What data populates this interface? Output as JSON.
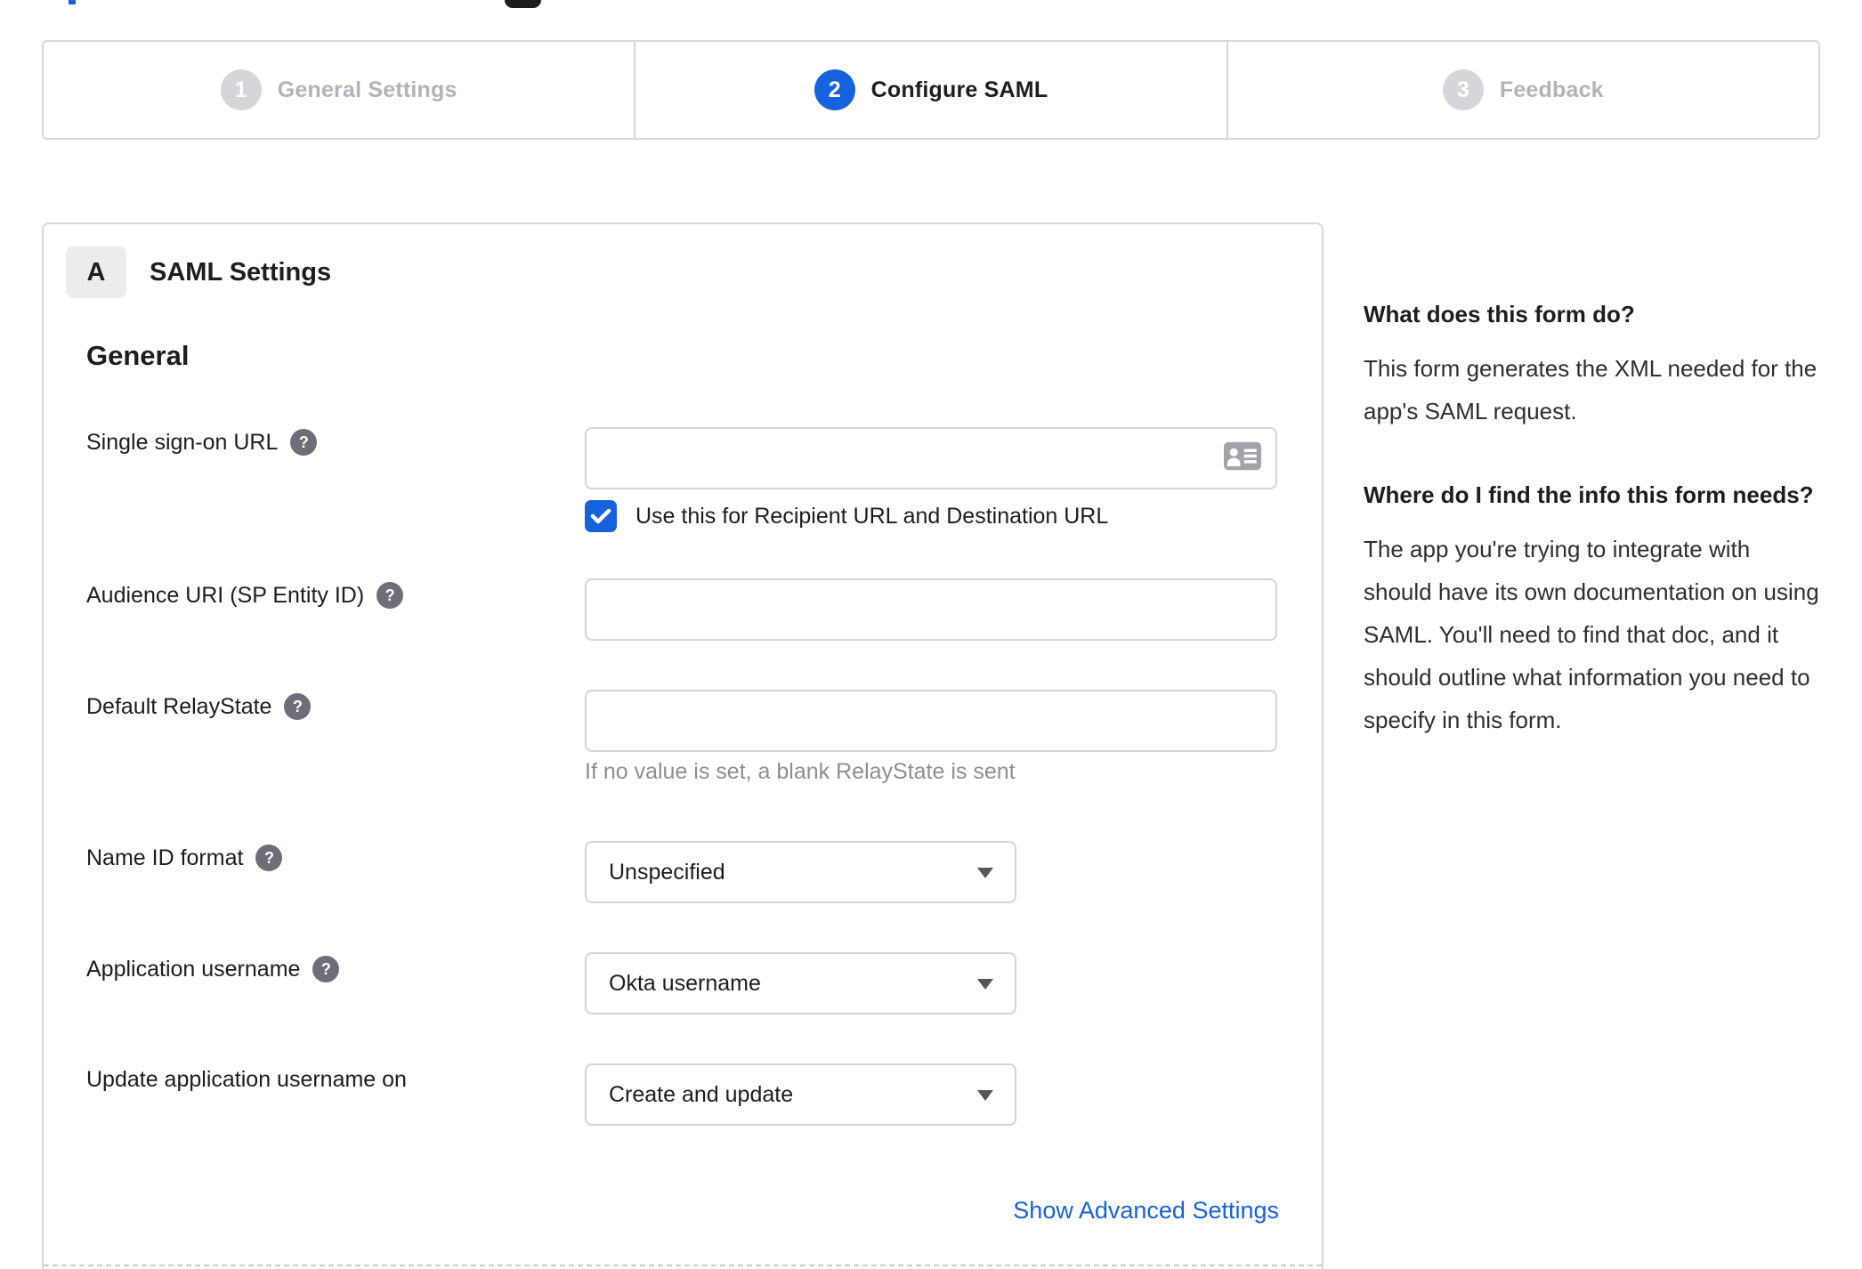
{
  "stepper": {
    "steps": [
      {
        "number": "1",
        "label": "General Settings",
        "state": "inactive"
      },
      {
        "number": "2",
        "label": "Configure SAML",
        "state": "active"
      },
      {
        "number": "3",
        "label": "Feedback",
        "state": "inactive"
      }
    ]
  },
  "panel": {
    "section_letter": "A",
    "section_title": "SAML Settings",
    "group_heading": "General",
    "fields": {
      "sso_url": {
        "label": "Single sign-on URL",
        "value": "",
        "checkbox_label": "Use this for Recipient URL and Destination URL",
        "checkbox_checked": true
      },
      "audience_uri": {
        "label": "Audience URI (SP Entity ID)",
        "value": ""
      },
      "relay_state": {
        "label": "Default RelayState",
        "value": "",
        "hint": "If no value is set, a blank RelayState is sent"
      },
      "name_id_format": {
        "label": "Name ID format",
        "value": "Unspecified"
      },
      "app_username": {
        "label": "Application username",
        "value": "Okta username"
      },
      "update_app_username": {
        "label": "Update application username on",
        "value": "Create and update"
      }
    },
    "advanced_link": "Show Advanced Settings"
  },
  "sidebar": {
    "sections": [
      {
        "heading": "What does this form do?",
        "body": "This form generates the XML needed for the app's SAML request."
      },
      {
        "heading": "Where do I find the info this form needs?",
        "body": "The app you're trying to integrate with should have its own documentation on using SAML. You'll need to find that doc, and it should outline what information you need to specify in this form."
      }
    ]
  },
  "icons": {
    "help_glyph": "?"
  },
  "colors": {
    "accent_blue": "#1662dd",
    "border_gray": "#d7d7dc",
    "text_dark": "#1d1d21",
    "inactive_gray": "#b2b2b9",
    "help_icon_bg": "#6e6e78",
    "hint_gray": "#8d8d95"
  }
}
